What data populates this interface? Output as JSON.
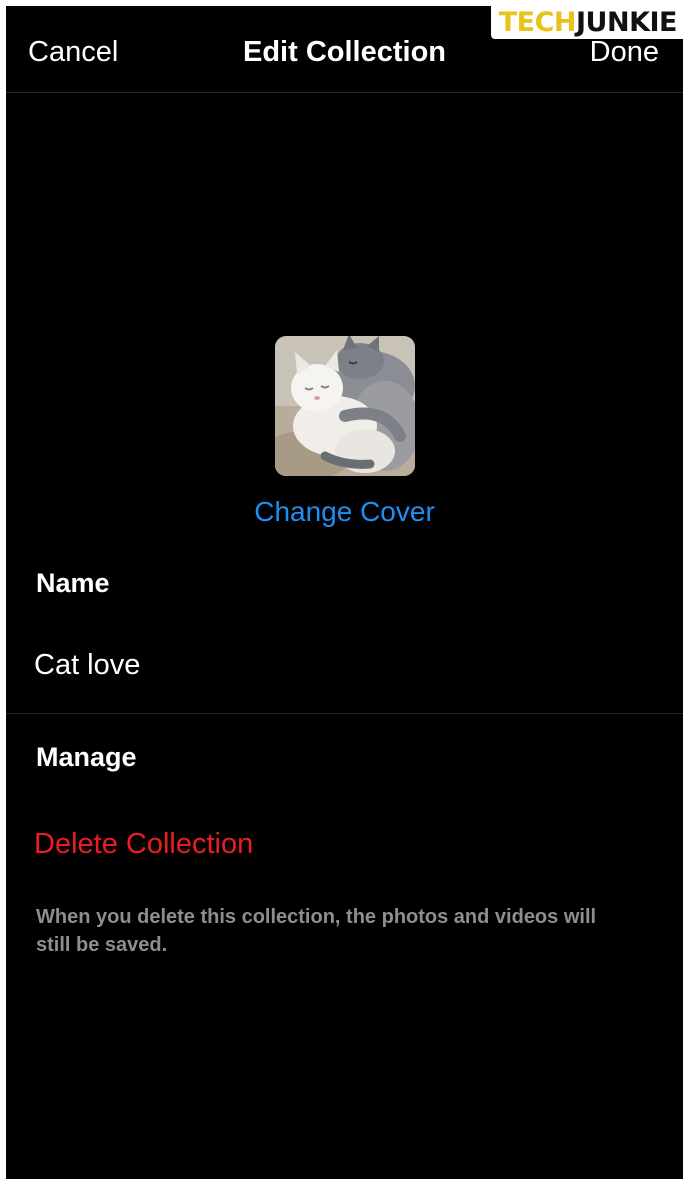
{
  "header": {
    "cancel_label": "Cancel",
    "title": "Edit Collection",
    "done_label": "Done"
  },
  "watermark": {
    "part1": "TECH",
    "part2": "JUNKIE"
  },
  "cover": {
    "image": "cat-photo",
    "change_label": "Change Cover"
  },
  "name_section": {
    "heading": "Name",
    "value": "Cat love"
  },
  "manage_section": {
    "heading": "Manage",
    "delete_label": "Delete Collection",
    "note": "When you delete this collection, the photos and videos will still be saved."
  },
  "colors": {
    "background": "#000000",
    "link_blue": "#1d8ff2",
    "destructive_red": "#ed1c24",
    "secondary_text": "#8e8e8e",
    "watermark_yellow": "#e8c31c"
  }
}
